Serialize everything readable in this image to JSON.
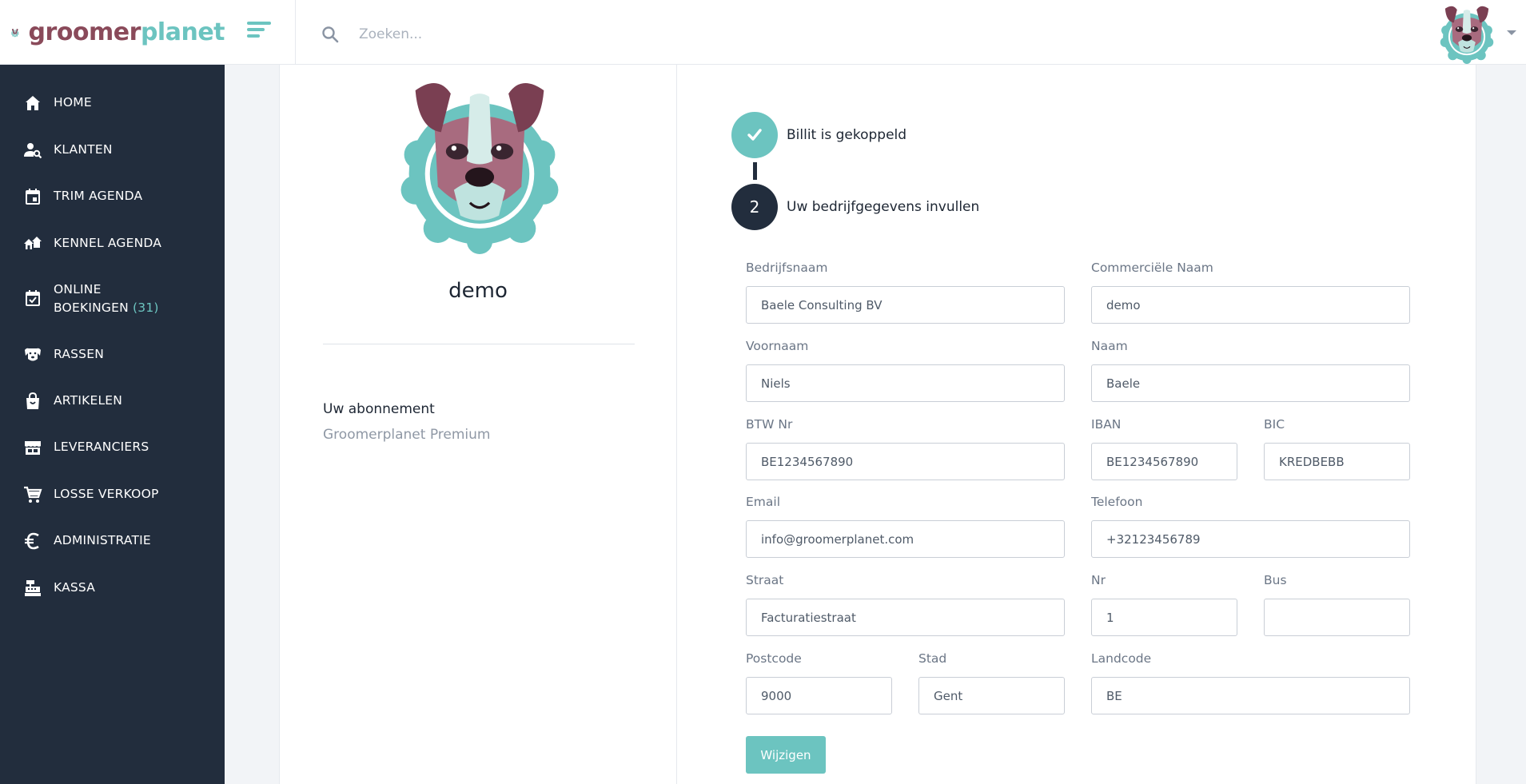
{
  "brand": {
    "name_part1": "groomer",
    "name_part2": "planet",
    "logo_icon": "dog-logo-icon"
  },
  "search": {
    "placeholder": "Zoeken..."
  },
  "colors": {
    "accent": "#6cc4c0",
    "sidebar": "#222d3d",
    "brand_dark": "#8a4a5a"
  },
  "sidebar": {
    "items": [
      {
        "label": "HOME",
        "icon": "home-icon"
      },
      {
        "label": "KLANTEN",
        "icon": "user-search-icon"
      },
      {
        "label": "TRIM AGENDA",
        "icon": "calendar-icon"
      },
      {
        "label": "KENNEL AGENDA",
        "icon": "kennel-icon"
      },
      {
        "label": "ONLINE",
        "label2": "BOEKINGEN",
        "count": "(31)",
        "icon": "calendar-check-icon"
      },
      {
        "label": "RASSEN",
        "icon": "dog-icon"
      },
      {
        "label": "ARTIKELEN",
        "icon": "shopping-bag-icon"
      },
      {
        "label": "LEVERANCIERS",
        "icon": "store-icon"
      },
      {
        "label": "LOSSE VERKOOP",
        "icon": "cart-icon"
      },
      {
        "label": "ADMINISTRATIE",
        "icon": "euro-icon"
      },
      {
        "label": "KASSA",
        "icon": "cash-register-icon"
      }
    ]
  },
  "profile": {
    "name": "demo",
    "subscription_label": "Uw abonnement",
    "subscription_value": "Groomerplanet Premium"
  },
  "steps": [
    {
      "label": "Billit is gekoppeld",
      "status": "done"
    },
    {
      "number": "2",
      "label": "Uw bedrijfgegevens invullen",
      "status": "current"
    }
  ],
  "form": {
    "bedrijfsnaam": {
      "label": "Bedrijfsnaam",
      "value": "Baele Consulting BV"
    },
    "commerciele_naam": {
      "label": "Commerciële Naam",
      "value": "demo"
    },
    "voornaam": {
      "label": "Voornaam",
      "value": "Niels"
    },
    "naam": {
      "label": "Naam",
      "value": "Baele"
    },
    "btw": {
      "label": "BTW Nr",
      "value": "BE1234567890"
    },
    "iban": {
      "label": "IBAN",
      "value": "BE1234567890"
    },
    "bic": {
      "label": "BIC",
      "value": "KREDBEBB"
    },
    "email": {
      "label": "Email",
      "value": "info@groomerplanet.com"
    },
    "telefoon": {
      "label": "Telefoon",
      "value": "+32123456789"
    },
    "straat": {
      "label": "Straat",
      "value": "Facturatiestraat"
    },
    "nr": {
      "label": "Nr",
      "value": "1"
    },
    "bus": {
      "label": "Bus",
      "value": ""
    },
    "postcode": {
      "label": "Postcode",
      "value": "9000"
    },
    "stad": {
      "label": "Stad",
      "value": "Gent"
    },
    "landcode": {
      "label": "Landcode",
      "value": "BE"
    },
    "submit_label": "Wijzigen"
  }
}
